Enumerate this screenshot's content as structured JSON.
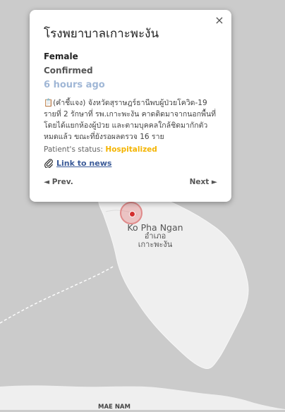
{
  "map": {
    "place_label_en": "Ko Pha Ngan",
    "place_label_th1": "อำเภอ",
    "place_label_th2": "เกาะพะงัน",
    "bottom_label": "MAE NAM"
  },
  "popup": {
    "title": "โรงพยาบาลเกาะพะงัน",
    "close_symbol": "×",
    "gender": "Female",
    "case_status": "Confirmed",
    "time_ago": "6 hours ago",
    "description": "📋(คำชี้แจง) จังหวัดสุราษฎร์ธานีพบผู้ป่วยโควิด-19 รายที่ 2 รักษาที่ รพ.เกาะพะงัน คาดติดมาจากนอกพื้นที่ โดยได้แยกห้องผู้ป่วย และตามบุคคลใกล้ชิดมากักตัวหมดแล้ว ขณะที่ยังรอผลตรวจ 16 ราย",
    "patient_status_label": "Patient's status:",
    "patient_status_value": "Hospitalized",
    "link_label": "Link to news",
    "prev_label": "◄ Prev.",
    "next_label": "Next ►"
  },
  "colors": {
    "map_land": "#efefef",
    "map_water": "#cbcbcb",
    "status_hospitalized": "#f4b400",
    "link": "#3a5a98",
    "marker": "#d32f2f"
  },
  "icons": {
    "link": "paperclip-icon",
    "close": "close-icon",
    "marker": "location-marker-icon"
  }
}
